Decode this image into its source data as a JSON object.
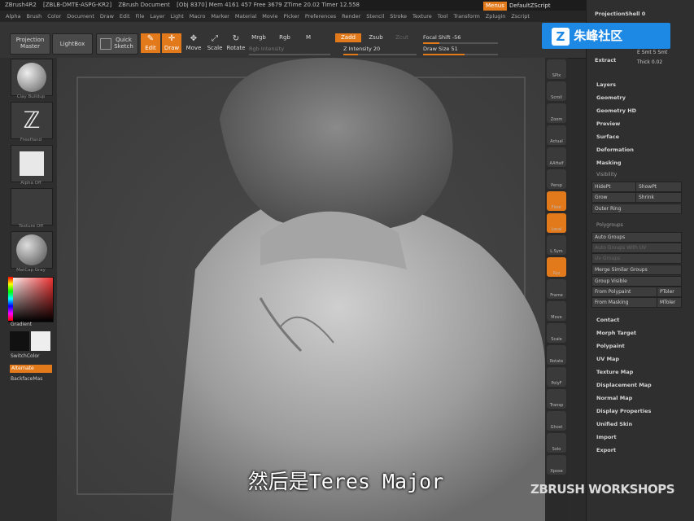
{
  "title_bar": {
    "app": "ZBrush4R2",
    "file": "[ZBLB-DMTE-ASPG-KR2]",
    "doc": "ZBrush Document",
    "stats": "[Obj 8370] Mem 4161 457 Free 3679 ZTime 20.02 Timer 12.558",
    "menus_btn": "Menus",
    "default_script": "DefaultZScript"
  },
  "menu_bar": [
    "Alpha",
    "Brush",
    "Color",
    "Document",
    "Draw",
    "Edit",
    "File",
    "Layer",
    "Light",
    "Macro",
    "Marker",
    "Material",
    "Movie",
    "Picker",
    "Preferences",
    "Render",
    "Stencil",
    "Stroke",
    "Texture",
    "Tool",
    "Transform",
    "Zplugin",
    "Zscript"
  ],
  "toolbar": {
    "projection_master": "Projection Master",
    "lightbox": "LightBox",
    "quick_sketch": "Quick Sketch",
    "edit": "Edit",
    "draw": "Draw",
    "move": "Move",
    "scale": "Scale",
    "rotate": "Rotate",
    "mrgb": "Mrgb",
    "rgb": "Rgb",
    "m": "M",
    "rgb_intensity": "Rgb Intensity",
    "zadd": "Zadd",
    "zsub": "Zsub",
    "zcut": "Zcut",
    "z_intensity_label": "Z Intensity",
    "z_intensity_value": "20",
    "focal_shift_label": "Focal Shift",
    "focal_shift_value": "-56",
    "draw_size_label": "Draw Size",
    "draw_size_value": "51"
  },
  "left_shelf": {
    "brush_label": "Clay Buildup",
    "stroke_label": "FreeHand",
    "alpha_label": "Alpha Off",
    "texture_label": "Texture Off",
    "material_label": "MatCap Gray",
    "gradient": "Gradient",
    "switch_color": "SwitchColor",
    "alternate": "Alternate",
    "backface": "BackfaceMas"
  },
  "right_shelf": [
    "SPix",
    "Scroll",
    "Zoom",
    "Actual",
    "AAHalf",
    "Persp",
    "Floor",
    "Local",
    "L.Sym",
    "Xyz",
    "Frame",
    "Move",
    "Scale",
    "Rotate",
    "PolyF",
    "Transp",
    "Ghost",
    "Solo",
    "Xpose"
  ],
  "palette": {
    "projection_shell": "ProjectionShell 0",
    "extract": "Extract",
    "smt": "E Smt 5 Smt",
    "thick": "Thick 0.02",
    "sections": [
      "Layers",
      "Geometry",
      "Geometry HD",
      "Preview",
      "Surface",
      "Deformation",
      "Masking"
    ],
    "visibility": "Visibility",
    "hidept": "HidePt",
    "showpt": "ShowPt",
    "grow": "Grow",
    "shrink": "Shrink",
    "outer_ring": "Outer Ring",
    "polygroups": "Polygroups",
    "auto_groups": "Auto Groups",
    "auto_groups_uv": "Auto Groups With UV",
    "uv_groups": "Uv Groups",
    "merge_similar": "Merge Similar Groups",
    "group_visible": "Group Visible",
    "from_polypaint": "From Polypaint",
    "ptoler": "PToler",
    "from_masking": "From Masking",
    "mtoler": "MToler",
    "sections2": [
      "Contact",
      "Morph Target",
      "Polypaint",
      "UV Map",
      "Texture Map",
      "Displacement Map",
      "Normal Map",
      "Display Properties",
      "Unified Skin",
      "Import",
      "Export"
    ]
  },
  "watermark": "朱峰社区",
  "caption": "然后是Teres Major",
  "workshops": "ZBRUSH WORKSHOPS",
  "colors": {
    "accent": "#e2791a",
    "watermark_bg": "#1e88e5"
  }
}
